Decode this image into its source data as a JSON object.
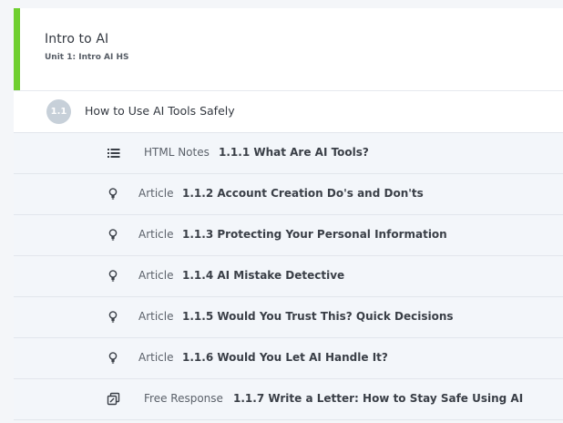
{
  "course": {
    "title": "Intro to AI",
    "subtitle": "Unit 1: Intro AI HS",
    "accent_color": "#6fcf2f"
  },
  "lesson": {
    "badge": "1.1",
    "title": "How to Use AI Tools Safely"
  },
  "items": [
    {
      "icon": "list-icon",
      "type": "HTML Notes",
      "title": "1.1.1 What Are AI Tools?"
    },
    {
      "icon": "lightbulb-icon",
      "type": "Article",
      "title": "1.1.2 Account Creation Do's and Don'ts"
    },
    {
      "icon": "lightbulb-icon",
      "type": "Article",
      "title": "1.1.3 Protecting Your Personal Information"
    },
    {
      "icon": "lightbulb-icon",
      "type": "Article",
      "title": "1.1.4 AI Mistake Detective"
    },
    {
      "icon": "lightbulb-icon",
      "type": "Article",
      "title": "1.1.5 Would You Trust This? Quick Decisions"
    },
    {
      "icon": "lightbulb-icon",
      "type": "Article",
      "title": "1.1.6 Would You Let AI Handle It?"
    },
    {
      "icon": "free-response-icon",
      "type": "Free Response",
      "title": "1.1.7 Write a Letter: How to Stay Safe Using AI"
    }
  ]
}
